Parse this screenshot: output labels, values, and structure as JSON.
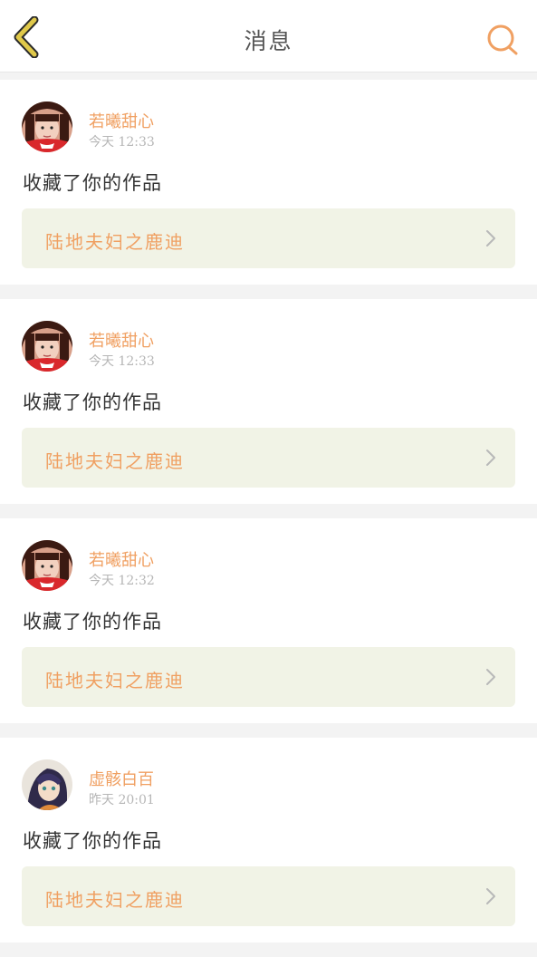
{
  "header": {
    "title": "消息",
    "back_icon": "chevron-left-icon",
    "search_icon": "search-icon"
  },
  "colors": {
    "accent": "#f0a062",
    "back_arrow": "#e0c94a",
    "work_card_bg": "#f1f3e6",
    "page_bg": "#f3f3f3"
  },
  "messages": [
    {
      "username": "若曦甜心",
      "time": "今天 12:33",
      "action": "收藏了你的作品",
      "work_title": "陆地夫妇之鹿迪"
    },
    {
      "username": "若曦甜心",
      "time": "今天 12:33",
      "action": "收藏了你的作品",
      "work_title": "陆地夫妇之鹿迪"
    },
    {
      "username": "若曦甜心",
      "time": "今天 12:32",
      "action": "收藏了你的作品",
      "work_title": "陆地夫妇之鹿迪"
    },
    {
      "username": "虚骸白百",
      "time": "昨天 20:01",
      "action": "收藏了你的作品",
      "work_title": "陆地夫妇之鹿迪"
    }
  ]
}
